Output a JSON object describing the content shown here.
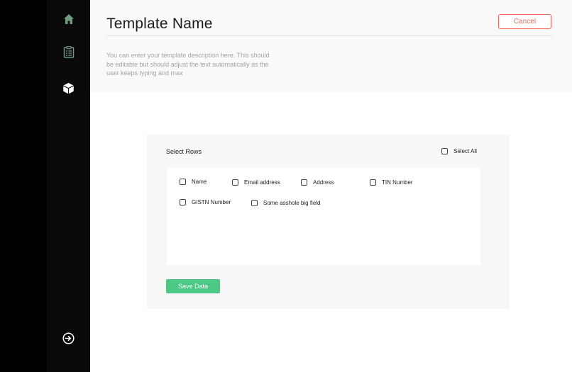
{
  "header": {
    "title": "Template Name",
    "cancel_label": "Cancel",
    "description": "You can enter your template description here. This should be editable but should adjust the text automatically as the user keeps typing and max"
  },
  "sidebar": {
    "items": [
      {
        "icon": "home-icon",
        "color": "#6f9b7e"
      },
      {
        "icon": "clipboard-list-icon",
        "color": "#6f9b7e"
      },
      {
        "icon": "cube-icon",
        "color": "#ffffff"
      }
    ],
    "logout_icon": "logout-icon"
  },
  "panel": {
    "title": "Select Rows",
    "select_all_label": "Select All",
    "fields": [
      {
        "label": "Name"
      },
      {
        "label": "Email address"
      },
      {
        "label": "Address"
      },
      {
        "label": "TIN Number"
      },
      {
        "label": "GISTN Number"
      },
      {
        "label": "Some asshole big field"
      }
    ],
    "save_label": "Save Data"
  },
  "colors": {
    "accent_green": "#4cc784",
    "cancel_red": "#ef6a5b",
    "sidebar_bg": "#0a0a0a"
  }
}
